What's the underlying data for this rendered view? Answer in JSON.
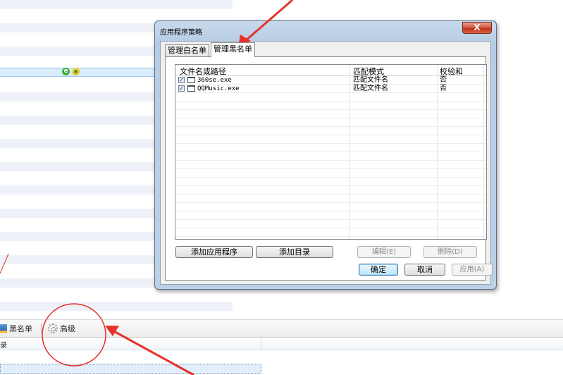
{
  "dialog": {
    "title": "应用程序策略",
    "close_glyph": "X",
    "tabs": [
      {
        "label": "管理白名单",
        "active": false
      },
      {
        "label": "管理黑名单",
        "active": true
      }
    ],
    "list": {
      "columns": [
        "文件名或路径",
        "匹配模式",
        "校验和"
      ],
      "rows": [
        {
          "checked": true,
          "file": "360se.exe",
          "mode": "匹配文件名",
          "checksum": "否"
        },
        {
          "checked": true,
          "file": "QQMusic.exe",
          "mode": "匹配文件名",
          "checksum": "否"
        }
      ]
    },
    "buttons": {
      "add_app": "添加应用程序",
      "add_dir": "添加目录",
      "edit": "编辑(E)",
      "delete": "删除(D)",
      "ok": "确定",
      "cancel": "取消",
      "apply": "应用(A)"
    }
  },
  "toolbar": {
    "blacklist_label": "黑名单",
    "advanced_label": "高级"
  },
  "bottom_header_text": "录",
  "icons": {
    "close": "close-icon",
    "checkbox": "checkbox-icon",
    "exe": "window-exe-icon",
    "gear": "gear-icon",
    "blacklist": "blacklist-icon",
    "ie": "ie-icon",
    "app": "ball-app-icon"
  },
  "colors": {
    "annotation_red": "#e8302a",
    "title_gradient": "#bcd0e6",
    "selected_row": "#d9ecf9"
  }
}
